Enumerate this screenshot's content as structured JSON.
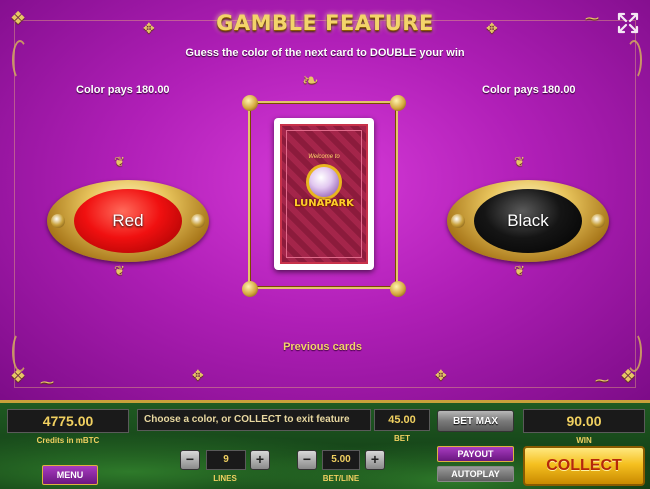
{
  "game": {
    "title": "GAMBLE FEATURE",
    "subtitle": "Guess the color of the next card to DOUBLE your win",
    "left_pays": "Color pays 180.00",
    "right_pays": "Color pays 180.00",
    "red_label": "Red",
    "black_label": "Black",
    "card_logo": "LUNAPARK",
    "card_tagline": "Welcome to",
    "previous_cards_label": "Previous cards",
    "fullscreen_icon": "expand-arrows-icon"
  },
  "panel": {
    "credits_value": "4775.00",
    "credits_label": "Credits in mBTC",
    "message": "Choose a color, or COLLECT to exit feature",
    "bet_value": "45.00",
    "bet_label": "BET",
    "bet_max_label": "BET MAX",
    "win_value": "90.00",
    "win_label": "WIN",
    "payout_label": "PAYOUT",
    "autoplay_label": "AUTOPLAY",
    "collect_label": "COLLECT",
    "menu_label": "MENU",
    "lines_value": "9",
    "lines_label": "LINES",
    "betline_value": "5.00",
    "betline_label": "BET/LINE",
    "minus_symbol": "−",
    "plus_symbol": "+"
  },
  "colors": {
    "stage_purple": "#b01fb7",
    "gold": "#f3d46a",
    "panel_green": "#1f5a22",
    "collect_yellow": "#f5c020"
  }
}
